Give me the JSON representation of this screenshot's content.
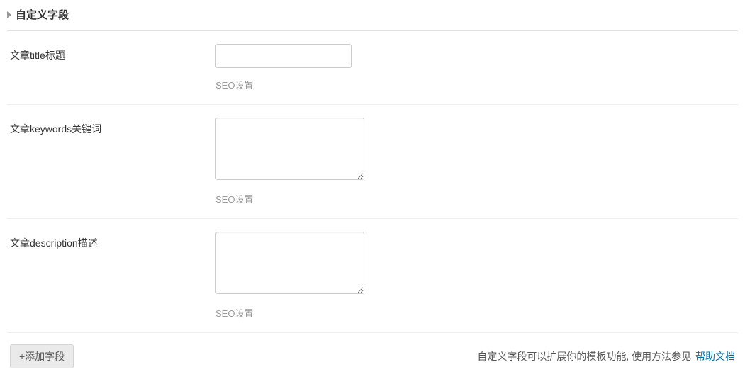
{
  "header": {
    "title": "自定义字段"
  },
  "fields": [
    {
      "label": "文章title标题",
      "help": "SEO设置",
      "type": "input",
      "value": ""
    },
    {
      "label": "文章keywords关键词",
      "help": "SEO设置",
      "type": "textarea",
      "value": ""
    },
    {
      "label": "文章description描述",
      "help": "SEO设置",
      "type": "textarea",
      "value": ""
    }
  ],
  "footer": {
    "add_button": "+添加字段",
    "hint_text": "自定义字段可以扩展你的模板功能, 使用方法参见",
    "help_link": "帮助文档"
  }
}
